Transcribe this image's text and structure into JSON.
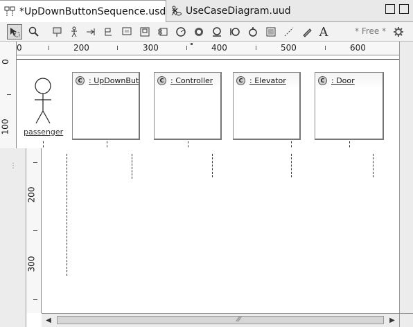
{
  "tabs": [
    {
      "label": "*UpDownButtonSequence.usd",
      "icon": "sequence-diagram-icon",
      "active": true
    },
    {
      "label": "UseCaseDiagram.uud",
      "icon": "usecase-diagram-icon",
      "active": false
    }
  ],
  "toolbar": {
    "free_label": "* Free *",
    "tools": [
      "select-tool-icon",
      "zoom-tool-icon",
      "note-tool-icon",
      "actor-tool-icon",
      "message-tool-icon",
      "return-message-tool-icon",
      "lifeline-tool-icon",
      "object-tool-icon",
      "component-tool-icon",
      "create-message-tool-icon",
      "destroy-tool-icon",
      "loop-tool-icon",
      "alt-fragment-tool-icon",
      "reply-tool-icon",
      "frame-tool-icon",
      "dashed-link-tool-icon",
      "pen-tool-icon",
      "text-tool-icon"
    ]
  },
  "ruler": {
    "horizontal": [
      "0",
      "200",
      "300",
      "400",
      "500",
      "600"
    ],
    "vertical": [
      "0",
      "100",
      "200",
      "300"
    ]
  },
  "diagram": {
    "actor": {
      "label": "passenger"
    },
    "lifelines": [
      {
        "name": ": UpDownButton",
        "icon": "class-icon",
        "icon_glyph": "C"
      },
      {
        "name": ": Controller",
        "icon": "class-icon",
        "icon_glyph": "C"
      },
      {
        "name": ": Elevator",
        "icon": "class-icon",
        "icon_glyph": "C"
      },
      {
        "name": ": Door",
        "icon": "class-icon",
        "icon_glyph": "C"
      }
    ]
  }
}
